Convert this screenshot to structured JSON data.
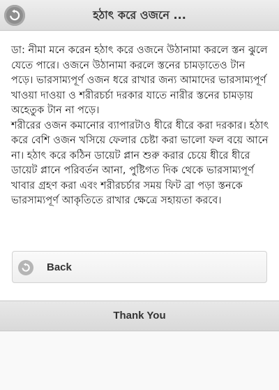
{
  "header": {
    "title": "হঠাৎ করে ওজনে ...",
    "back_icon": "back-arrow-icon"
  },
  "article": {
    "paragraphs": [
      "ডা: নীমা মনে করেন হঠাৎ করে ওজনে উঠানামা করলে স্তন ঝুলে যেতে পারে। ওজনে উঠানামা করলে স্তনের চামড়াতেও টান পড়ে। ভারসাম্যপূর্ণ ওজন ধরে রাখার জন্য আমাদের ভারসাম্যপূর্ণ খাওয়া দাওয়া ও শরীরচর্চা দরকার যাতে নারীর স্তনের চামড়ায় অহেতুক টান না পড়ে।",
      "শরীরের ওজন কমানোর ব্যাপারটাও ধীরে ধীরে করা দরকার। হঠাৎ করে বেশি ওজন খসিয়ে ফেলার চেষ্টা করা ভালো ফল বয়ে আনে না। হঠাৎ করে কঠিন ডায়েট প্লান শুরু করার চেয়ে ধীরে ধীরে ডায়েট প্লানে পরিবর্তন আনা, পুষ্টিগত দিক থেকে ভারসাম্যপূর্ণ খাবার গ্রহণ করা এবং শরীরচর্চার সময় ফিট ব্রা পড়া স্তনকে ভারসাম্যপূর্ণ আকৃতিতে রাখার ক্ষেত্রে সহায়তা করবে।"
    ]
  },
  "back_button": {
    "label": "Back",
    "icon": "back-arrow-icon"
  },
  "footer": {
    "title": "Thank You"
  },
  "colors": {
    "header_bg": "#e4e4e4",
    "content_bg": "#ffffff",
    "page_bg": "#f9f9f9",
    "icon_circle": "#8e8e8e"
  }
}
